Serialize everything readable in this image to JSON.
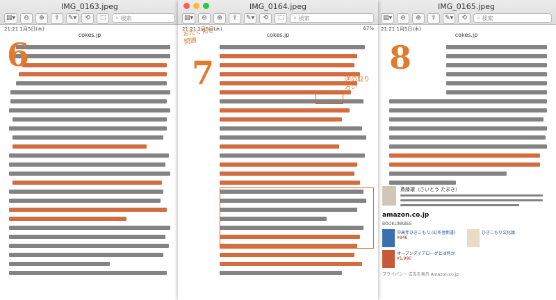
{
  "windows": {
    "left": {
      "title": "IMG_0163.jpeg",
      "search_placeholder": "検索",
      "status_time": "21:21",
      "status_date": "1月5日(木)",
      "url": "cokes.jp",
      "annotation": "6"
    },
    "middle": {
      "title": "IMG_0164.jpeg",
      "search_placeholder": "検索",
      "status_time": "21:21",
      "status_date": "1月5日(木)",
      "status_battery": "67%",
      "url": "cokes.jp",
      "annotation": "7",
      "side_note_left": "おたく化を\n問題",
      "side_note_right": "逆の取り\n方い"
    },
    "right": {
      "title": "IMG_0165.jpeg",
      "search_placeholder": "検索",
      "status_time": "21:21",
      "status_date": "1月5日(木)",
      "url": "cokes.jp",
      "annotation": "8",
      "author_name": "斎藤環（さいとう たまき）",
      "amazon_label": "amazon.co.jp",
      "amazon_section": "BOOKLINKBEE",
      "products": [
        {
          "title": "中高年ひきこもり (幻冬舎新書)",
          "price": "¥946"
        },
        {
          "title": "ひきこもり文化論",
          "price": ""
        },
        {
          "title": "オープンダイアローグとは何か",
          "price": "¥1,980"
        }
      ],
      "footer": "プライバシー 広告を表示 Amazon.co.jp"
    }
  },
  "colors": {
    "annotation": "#e07a2e",
    "highlight": "#c9531f"
  }
}
